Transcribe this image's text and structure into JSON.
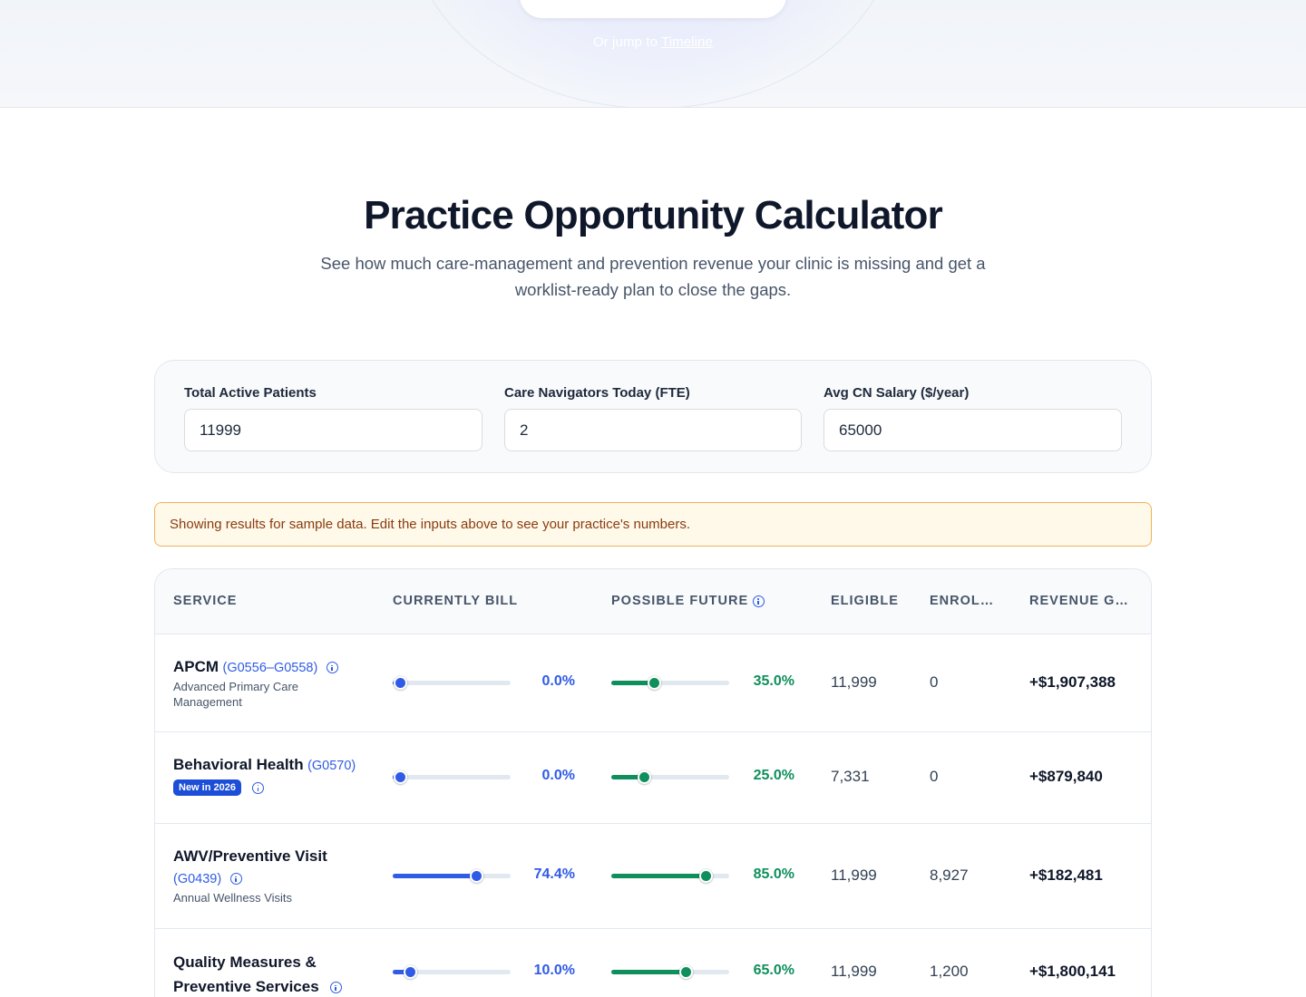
{
  "hero": {
    "jump_prefix": "Or jump to",
    "jump_link": "Timeline"
  },
  "title": "Practice Opportunity Calculator",
  "subtitle": "See how much care-management and prevention revenue your clinic is missing and get a worklist-ready plan to close the gaps.",
  "inputs": {
    "patients": {
      "label": "Total Active Patients",
      "value": "11999"
    },
    "navigators": {
      "label": "Care Navigators Today (FTE)",
      "value": "2"
    },
    "salary": {
      "label": "Avg CN Salary ($/year)",
      "value": "65000"
    }
  },
  "notice": "Showing results for sample data. Edit the inputs above to see your practice's numbers.",
  "table": {
    "headers": {
      "service": "Service",
      "current": "Currently Bill",
      "future": "Possible Future",
      "eligible": "Eligible",
      "enrolled": "Enrolled",
      "revenue": "Revenue Gain"
    },
    "rows": [
      {
        "name": "APCM",
        "code": "(G0556–G0558)",
        "desc": "Advanced Primary Care Management",
        "badge": "",
        "current_pct": 0.0,
        "current_label": "0.0%",
        "future_pct": 35.0,
        "future_label": "35.0%",
        "eligible": "11,999",
        "enrolled": "0",
        "revenue": "+$1,907,388"
      },
      {
        "name": "Behavioral Health",
        "code": "(G0570)",
        "desc": "",
        "badge": "New in 2026",
        "current_pct": 0.0,
        "current_label": "0.0%",
        "future_pct": 25.0,
        "future_label": "25.0%",
        "eligible": "7,331",
        "enrolled": "0",
        "revenue": "+$879,840"
      },
      {
        "name": "AWV/Preventive Visit",
        "code": "(G0439)",
        "desc": "Annual Wellness Visits",
        "badge": "",
        "current_pct": 74.4,
        "current_label": "74.4%",
        "future_pct": 85.0,
        "future_label": "85.0%",
        "eligible": "11,999",
        "enrolled": "8,927",
        "revenue": "+$182,481"
      },
      {
        "name": "Quality Measures & Preventive Services",
        "code": "",
        "desc": "",
        "badge": "",
        "current_pct": 10.0,
        "current_label": "10.0%",
        "future_pct": 65.0,
        "future_label": "65.0%",
        "eligible": "11,999",
        "enrolled": "1,200",
        "revenue": "+$1,800,141"
      }
    ]
  },
  "colors": {
    "primary_blue": "#2f5be7",
    "success_green": "#0f8f5c",
    "notice_bg": "#fef9e8",
    "notice_border": "#f0b25a"
  }
}
